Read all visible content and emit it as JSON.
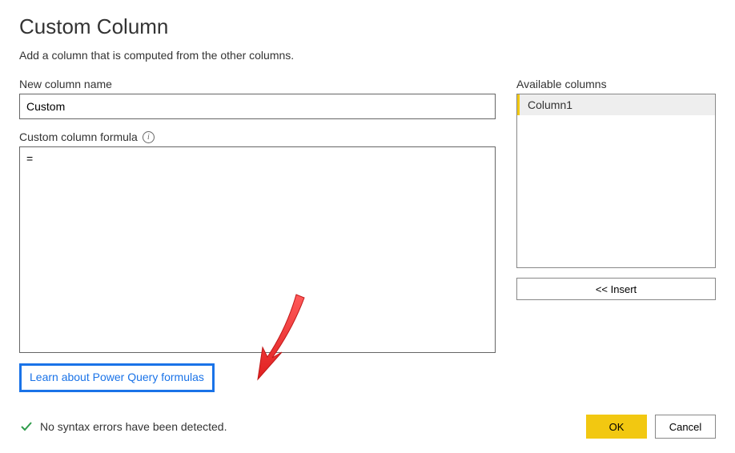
{
  "title": "Custom Column",
  "subtitle": "Add a column that is computed from the other columns.",
  "name_field": {
    "label": "New column name",
    "value": "Custom"
  },
  "formula_field": {
    "label": "Custom column formula",
    "value": "="
  },
  "available_columns": {
    "label": "Available columns",
    "items": [
      "Column1"
    ],
    "insert_label": "<< Insert"
  },
  "link_text": "Learn about Power Query formulas",
  "status_text": "No syntax errors have been detected.",
  "buttons": {
    "ok": "OK",
    "cancel": "Cancel"
  }
}
